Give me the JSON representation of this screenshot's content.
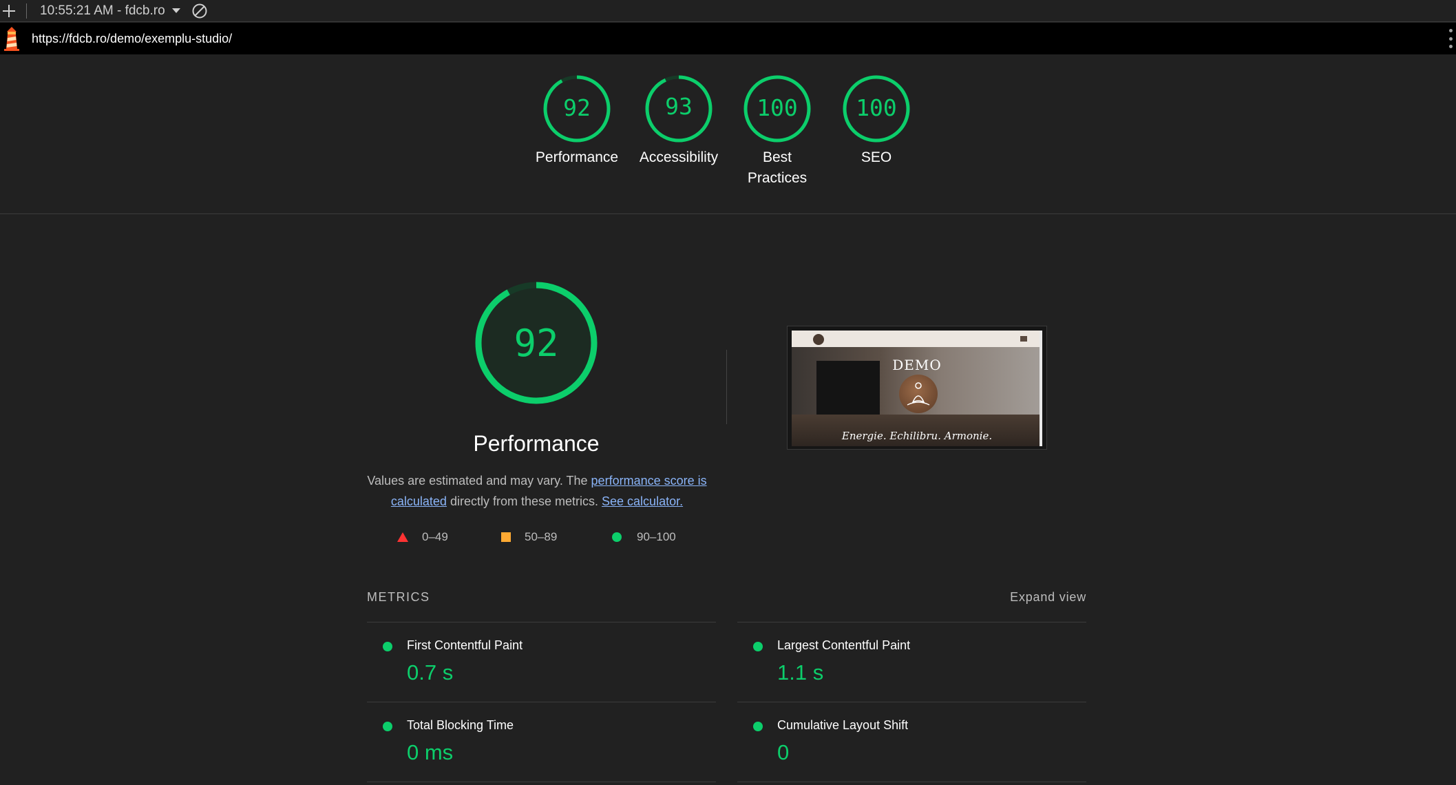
{
  "topbar": {
    "report_label": "10:55:21 AM - fdcb.ro"
  },
  "urlbar": {
    "url": "https://fdcb.ro/demo/exemplu-studio/"
  },
  "colors": {
    "pass": "#0cce6b",
    "average": "#ffaa33",
    "fail": "#ff3333"
  },
  "categories": [
    {
      "score": "92",
      "label": "Performance",
      "fraction": 0.92
    },
    {
      "score": "93",
      "label": "Accessibility",
      "fraction": 0.93
    },
    {
      "score": "100",
      "label": "Best Practices",
      "fraction": 1.0
    },
    {
      "score": "100",
      "label": "SEO",
      "fraction": 1.0
    }
  ],
  "performance": {
    "score": "92",
    "fraction": 0.92,
    "title": "Performance",
    "desc_prefix": "Values are estimated and may vary. The ",
    "link_score": "performance score is calculated",
    "desc_middle": " directly from these metrics. ",
    "link_calculator": "See calculator."
  },
  "legend": {
    "fail": "0–49",
    "average": "50–89",
    "pass": "90–100"
  },
  "screenshot": {
    "heading": "DEMO",
    "tagline": "Energie. Echilibru. Armonie."
  },
  "metrics": {
    "title": "METRICS",
    "expand_label": "Expand view",
    "items": [
      {
        "name": "First Contentful Paint",
        "value": "0.7 s"
      },
      {
        "name": "Largest Contentful Paint",
        "value": "1.1 s"
      },
      {
        "name": "Total Blocking Time",
        "value": "0 ms"
      },
      {
        "name": "Cumulative Layout Shift",
        "value": "0"
      }
    ]
  }
}
